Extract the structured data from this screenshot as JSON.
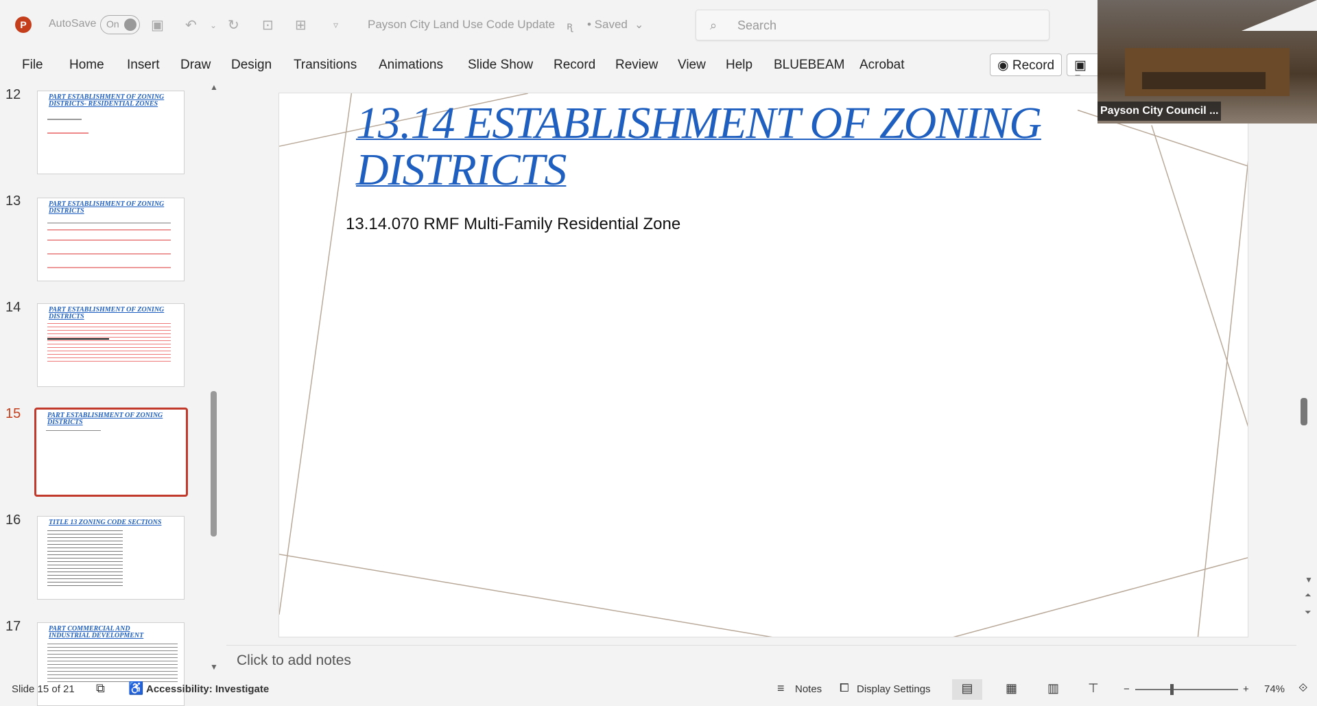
{
  "titlebar": {
    "autosave_label": "AutoSave",
    "toggle_label": "On",
    "doc_title": "Payson City Land Use Code Update",
    "saved": "• Saved",
    "search_placeholder": "Search"
  },
  "menu": [
    "File",
    "Home",
    "Insert",
    "Draw",
    "Design",
    "Transitions",
    "Animations",
    "Slide Show",
    "Record",
    "Review",
    "View",
    "Help",
    "BLUEBEAM",
    "Acrobat"
  ],
  "ribbon_buttons": {
    "record": "Record",
    "present": "Pr"
  },
  "thumbnails": [
    {
      "num": "12",
      "title": "PART ESTABLISHMENT OF ZONING DISTRICTS- RESIDENTIAL ZONES"
    },
    {
      "num": "13",
      "title": "PART ESTABLISHMENT OF ZONING DISTRICTS"
    },
    {
      "num": "14",
      "title": "PART ESTABLISHMENT OF ZONING DISTRICTS"
    },
    {
      "num": "15",
      "title": "PART ESTABLISHMENT OF ZONING DISTRICTS"
    },
    {
      "num": "16",
      "title": "TITLE 13 ZONING CODE SECTIONS"
    },
    {
      "num": "17",
      "title": "PART COMMERCIAL AND INDUSTRIAL DEVELOPMENT"
    }
  ],
  "slide": {
    "title": "13.14 ESTABLISHMENT OF ZONING DISTRICTS",
    "subtitle": "13.14.070 RMF Multi-Family Residential Zone"
  },
  "notes_placeholder": "Click to add notes",
  "status": {
    "slide_info": "Slide 15 of 21",
    "accessibility": "Accessibility: Investigate",
    "notes": "Notes",
    "display_settings": "Display Settings",
    "zoom": "74%"
  },
  "video": {
    "label": "Payson City Council ..."
  },
  "colors": {
    "accent": "#c43e1c",
    "title_blue": "#1f5fbf"
  }
}
